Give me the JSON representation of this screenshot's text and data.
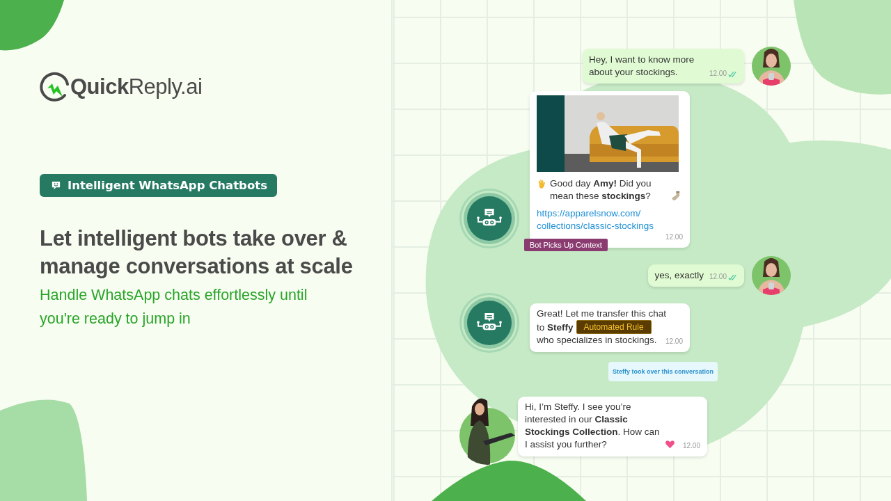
{
  "brand": {
    "logo": "**Quick**Reply.ai"
  },
  "badge": {
    "label": "Intelligent WhatsApp Chatbots"
  },
  "headline": "Let intelligent bots take over & manage conversations at scale",
  "subheadline": "Handle WhatsApp chats effortlessly until you're ready to jump in",
  "chat": {
    "messages": [
      {
        "kind": "user",
        "lines": [
          [
            {
              "kind": "text",
              "text": "Hey, I want to know more about your stockings."
            }
          ]
        ],
        "time": "12.00"
      },
      {
        "kind": "bot",
        "media": {
          "kind": "picture"
        },
        "lines": [
          [
            {
              "kind": "wave"
            },
            {
              "kind": "text",
              "text": "Good day **Amy!** Did you mean these **stockings**?"
            },
            {
              "kind": "sock"
            }
          ]
        ],
        "link_lines": [
          "https://apparelsnow.com/",
          "collections/classic-stockings"
        ],
        "time": "12.00",
        "tag": "Bot Picks Up Context"
      },
      {
        "kind": "user",
        "lines": [
          [
            {
              "kind": "text",
              "text": "yes, exactly"
            }
          ]
        ],
        "time": "12.00"
      },
      {
        "kind": "bot",
        "lines": [
          [
            {
              "kind": "text",
              "text": "Great! Let me transfer this chat"
            }
          ],
          [
            {
              "kind": "text",
              "text": "to **Steffy**"
            },
            {
              "kind": "tag",
              "text": "Automated Rule"
            }
          ],
          [
            {
              "kind": "text",
              "text": "who specializes in stockings."
            }
          ]
        ],
        "time": "12.00"
      },
      {
        "kind": "note",
        "text": "Steffy took over this conversation"
      },
      {
        "kind": "agent",
        "lines": [
          [
            {
              "kind": "text",
              "text": "Hi, I’m Steffy. I see you’re interested in our **Classic Stockings Collection**. How can I assist you further?"
            },
            {
              "kind": "heart"
            }
          ]
        ],
        "time": "12.00"
      }
    ]
  }
}
